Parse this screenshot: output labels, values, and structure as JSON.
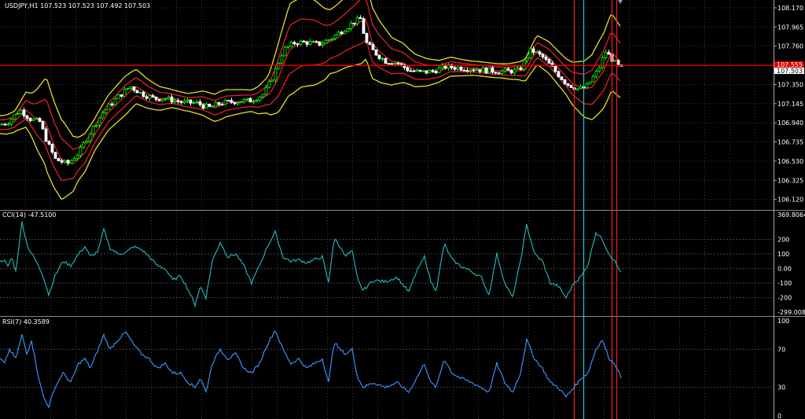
{
  "chart_data": [
    {
      "type": "candlestick",
      "title": "USDJPY,H1  107.523 107.523 107.492 107.503",
      "y_ticks": [
        "108.170",
        "107.965",
        "107.760",
        "107.350",
        "107.145",
        "106.940",
        "106.735",
        "106.530",
        "106.325",
        "106.120"
      ],
      "ylim": [
        106.05,
        108.22
      ],
      "price_badges": [
        "107.555",
        "107.503"
      ],
      "colors": {
        "bull": "#00ff00",
        "bear": "#ffffff",
        "inner_band": "#e0202a",
        "outer_band": "#e8e020",
        "hline": "#e00000",
        "vline_cyan": "#20c0d0",
        "vline_red": "#e02020"
      },
      "price_line": 107.555,
      "anchors_mid": [
        [
          0,
          106.92
        ],
        [
          10,
          106.95
        ],
        [
          25,
          107.08
        ],
        [
          38,
          106.98
        ],
        [
          50,
          106.95
        ],
        [
          60,
          106.72
        ],
        [
          70,
          106.55
        ],
        [
          85,
          106.5
        ],
        [
          100,
          106.62
        ],
        [
          115,
          106.85
        ],
        [
          130,
          107.05
        ],
        [
          150,
          107.22
        ],
        [
          165,
          107.33
        ],
        [
          180,
          107.25
        ],
        [
          195,
          107.2
        ],
        [
          210,
          107.2
        ],
        [
          230,
          107.16
        ],
        [
          250,
          107.15
        ],
        [
          265,
          107.1
        ],
        [
          280,
          107.15
        ],
        [
          300,
          107.17
        ],
        [
          320,
          107.18
        ],
        [
          335,
          107.25
        ],
        [
          345,
          107.4
        ],
        [
          360,
          107.72
        ],
        [
          375,
          107.8
        ],
        [
          390,
          107.8
        ],
        [
          405,
          107.78
        ],
        [
          420,
          107.84
        ],
        [
          435,
          107.93
        ],
        [
          450,
          108.02
        ],
        [
          458,
          108.05
        ],
        [
          465,
          107.8
        ],
        [
          475,
          107.7
        ],
        [
          490,
          107.6
        ],
        [
          505,
          107.58
        ],
        [
          520,
          107.5
        ],
        [
          535,
          107.48
        ],
        [
          550,
          107.49
        ],
        [
          565,
          107.54
        ],
        [
          580,
          107.53
        ],
        [
          600,
          107.52
        ],
        [
          620,
          107.5
        ],
        [
          640,
          107.49
        ],
        [
          660,
          107.5
        ],
        [
          675,
          107.72
        ],
        [
          690,
          107.64
        ],
        [
          705,
          107.5
        ],
        [
          720,
          107.36
        ],
        [
          735,
          107.3
        ],
        [
          745,
          107.32
        ],
        [
          760,
          107.5
        ],
        [
          770,
          107.7
        ],
        [
          778,
          107.62
        ],
        [
          785,
          107.55
        ],
        [
          790,
          107.52
        ]
      ],
      "band_width": [
        [
          0,
          0.05
        ],
        [
          20,
          0.06
        ],
        [
          40,
          0.12
        ],
        [
          60,
          0.26
        ],
        [
          80,
          0.22
        ],
        [
          100,
          0.12
        ],
        [
          120,
          0.09
        ],
        [
          140,
          0.1
        ],
        [
          160,
          0.11
        ],
        [
          180,
          0.09
        ],
        [
          200,
          0.07
        ],
        [
          220,
          0.05
        ],
        [
          240,
          0.05
        ],
        [
          260,
          0.07
        ],
        [
          280,
          0.08
        ],
        [
          300,
          0.07
        ],
        [
          320,
          0.06
        ],
        [
          340,
          0.1
        ],
        [
          355,
          0.2
        ],
        [
          370,
          0.26
        ],
        [
          400,
          0.24
        ],
        [
          420,
          0.18
        ],
        [
          440,
          0.2
        ],
        [
          460,
          0.24
        ],
        [
          480,
          0.18
        ],
        [
          500,
          0.13
        ],
        [
          520,
          0.1
        ],
        [
          540,
          0.08
        ],
        [
          560,
          0.06
        ],
        [
          580,
          0.05
        ],
        [
          600,
          0.04
        ],
        [
          620,
          0.04
        ],
        [
          640,
          0.04
        ],
        [
          660,
          0.05
        ],
        [
          680,
          0.08
        ],
        [
          700,
          0.09
        ],
        [
          720,
          0.1
        ],
        [
          740,
          0.15
        ],
        [
          760,
          0.2
        ],
        [
          775,
          0.22
        ],
        [
          790,
          0.2
        ]
      ],
      "vlines_cyan": [
        742
      ],
      "vlines_red": [
        730,
        778,
        784
      ]
    },
    {
      "type": "line",
      "title": "CCI(14) -47.5100",
      "y_ticks": [
        "369.8064",
        "200",
        "100",
        "0.00",
        "-100",
        "-200",
        "-299.0084"
      ],
      "ylim": [
        -299.0084,
        369.8064
      ],
      "line_color": "#20b0b0",
      "anchors": [
        [
          0,
          50
        ],
        [
          5,
          60
        ],
        [
          10,
          10
        ],
        [
          15,
          80
        ],
        [
          20,
          -20
        ],
        [
          28,
          320
        ],
        [
          35,
          150
        ],
        [
          45,
          60
        ],
        [
          55,
          -50
        ],
        [
          62,
          -180
        ],
        [
          70,
          -50
        ],
        [
          80,
          50
        ],
        [
          90,
          20
        ],
        [
          100,
          100
        ],
        [
          108,
          150
        ],
        [
          115,
          80
        ],
        [
          125,
          120
        ],
        [
          132,
          270
        ],
        [
          140,
          140
        ],
        [
          150,
          100
        ],
        [
          160,
          110
        ],
        [
          170,
          150
        ],
        [
          180,
          130
        ],
        [
          190,
          80
        ],
        [
          200,
          20
        ],
        [
          210,
          0
        ],
        [
          220,
          -80
        ],
        [
          230,
          -50
        ],
        [
          240,
          -150
        ],
        [
          248,
          -250
        ],
        [
          255,
          -120
        ],
        [
          262,
          -200
        ],
        [
          270,
          50
        ],
        [
          280,
          180
        ],
        [
          290,
          80
        ],
        [
          300,
          100
        ],
        [
          310,
          20
        ],
        [
          320,
          -100
        ],
        [
          330,
          20
        ],
        [
          340,
          150
        ],
        [
          350,
          250
        ],
        [
          360,
          80
        ],
        [
          370,
          50
        ],
        [
          380,
          60
        ],
        [
          390,
          40
        ],
        [
          400,
          60
        ],
        [
          410,
          80
        ],
        [
          418,
          -100
        ],
        [
          425,
          210
        ],
        [
          432,
          150
        ],
        [
          440,
          90
        ],
        [
          448,
          120
        ],
        [
          455,
          -80
        ],
        [
          462,
          -150
        ],
        [
          475,
          -80
        ],
        [
          490,
          -90
        ],
        [
          505,
          -60
        ],
        [
          520,
          -160
        ],
        [
          530,
          -20
        ],
        [
          540,
          80
        ],
        [
          548,
          -90
        ],
        [
          555,
          -150
        ],
        [
          565,
          170
        ],
        [
          575,
          60
        ],
        [
          585,
          20
        ],
        [
          600,
          -20
        ],
        [
          612,
          -60
        ],
        [
          622,
          -180
        ],
        [
          632,
          100
        ],
        [
          642,
          -100
        ],
        [
          652,
          -200
        ],
        [
          662,
          50
        ],
        [
          670,
          300
        ],
        [
          680,
          100
        ],
        [
          690,
          50
        ],
        [
          700,
          -100
        ],
        [
          710,
          -120
        ],
        [
          720,
          -200
        ],
        [
          730,
          -100
        ],
        [
          740,
          -50
        ],
        [
          748,
          30
        ],
        [
          758,
          250
        ],
        [
          766,
          200
        ],
        [
          775,
          100
        ],
        [
          782,
          50
        ],
        [
          790,
          -30
        ]
      ],
      "vlines_cyan": [
        742
      ],
      "vlines_red": [
        730,
        778,
        784
      ]
    },
    {
      "type": "line",
      "title": "RSI(7) 40.3589",
      "y_ticks": [
        "100",
        "70",
        "30",
        "0"
      ],
      "ylim": [
        0,
        100
      ],
      "line_color": "#3a8ff0",
      "anchors": [
        [
          0,
          60
        ],
        [
          6,
          55
        ],
        [
          12,
          70
        ],
        [
          20,
          60
        ],
        [
          28,
          85
        ],
        [
          34,
          65
        ],
        [
          40,
          80
        ],
        [
          48,
          45
        ],
        [
          55,
          20
        ],
        [
          62,
          10
        ],
        [
          70,
          30
        ],
        [
          80,
          45
        ],
        [
          90,
          35
        ],
        [
          100,
          55
        ],
        [
          108,
          60
        ],
        [
          115,
          50
        ],
        [
          125,
          70
        ],
        [
          132,
          85
        ],
        [
          140,
          70
        ],
        [
          150,
          80
        ],
        [
          160,
          88
        ],
        [
          170,
          75
        ],
        [
          180,
          65
        ],
        [
          190,
          60
        ],
        [
          200,
          50
        ],
        [
          210,
          55
        ],
        [
          220,
          45
        ],
        [
          230,
          45
        ],
        [
          240,
          35
        ],
        [
          248,
          30
        ],
        [
          255,
          40
        ],
        [
          262,
          25
        ],
        [
          270,
          55
        ],
        [
          280,
          70
        ],
        [
          290,
          60
        ],
        [
          300,
          65
        ],
        [
          310,
          50
        ],
        [
          320,
          45
        ],
        [
          330,
          55
        ],
        [
          340,
          75
        ],
        [
          350,
          90
        ],
        [
          360,
          70
        ],
        [
          370,
          55
        ],
        [
          380,
          60
        ],
        [
          390,
          50
        ],
        [
          400,
          55
        ],
        [
          410,
          60
        ],
        [
          418,
          35
        ],
        [
          425,
          78
        ],
        [
          432,
          70
        ],
        [
          440,
          65
        ],
        [
          448,
          70
        ],
        [
          455,
          40
        ],
        [
          462,
          30
        ],
        [
          475,
          35
        ],
        [
          490,
          30
        ],
        [
          505,
          35
        ],
        [
          520,
          25
        ],
        [
          530,
          40
        ],
        [
          540,
          55
        ],
        [
          548,
          35
        ],
        [
          555,
          30
        ],
        [
          565,
          60
        ],
        [
          575,
          45
        ],
        [
          585,
          40
        ],
        [
          600,
          35
        ],
        [
          612,
          30
        ],
        [
          622,
          25
        ],
        [
          632,
          55
        ],
        [
          642,
          35
        ],
        [
          652,
          25
        ],
        [
          662,
          45
        ],
        [
          670,
          80
        ],
        [
          680,
          60
        ],
        [
          690,
          50
        ],
        [
          700,
          35
        ],
        [
          710,
          30
        ],
        [
          720,
          20
        ],
        [
          730,
          30
        ],
        [
          740,
          40
        ],
        [
          748,
          45
        ],
        [
          758,
          70
        ],
        [
          766,
          80
        ],
        [
          775,
          60
        ],
        [
          782,
          55
        ],
        [
          790,
          40
        ]
      ],
      "levels": [
        70,
        30
      ],
      "vlines_cyan": [
        742
      ],
      "vlines_red": [
        730,
        778,
        784
      ]
    }
  ]
}
